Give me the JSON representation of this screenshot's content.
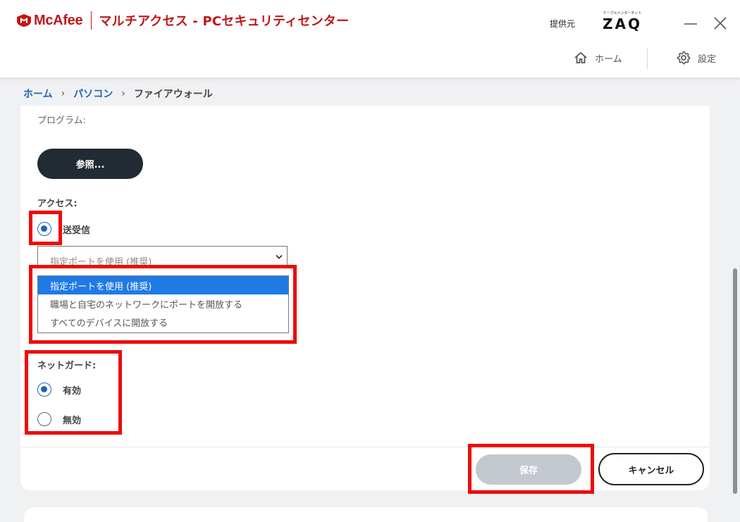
{
  "header": {
    "brand": "McAfee",
    "product": "マルチアクセス - PCセキュリティセンター",
    "provider_label": "提供元",
    "provider_small": "ケーブルインターネット",
    "provider_logo": "ZAQ",
    "nav": {
      "home": "ホーム",
      "settings": "設定"
    }
  },
  "breadcrumb": {
    "home": "ホーム",
    "pc": "パソコン",
    "current": "ファイアウォール"
  },
  "form": {
    "program_label": "プログラム:",
    "browse_button": "参照...",
    "access_label": "アクセス:",
    "access_option": "送受信",
    "port_select_value": "指定ポートを使用 (推奨)",
    "port_options": [
      {
        "label": "指定ポートを使用 (推奨)"
      },
      {
        "label": "職場と自宅のネットワークにポートを開放する"
      },
      {
        "label": "すべてのデバイスに開放する"
      }
    ],
    "netguard_label": "ネットガード:",
    "netguard_on": "有効",
    "netguard_off": "無効",
    "save_button": "保存",
    "cancel_button": "キャンセル"
  },
  "colors": {
    "brand_red": "#c01818",
    "link_blue": "#1e63b8",
    "highlight": "#ee0a0a",
    "selected": "#1f7ae6"
  }
}
